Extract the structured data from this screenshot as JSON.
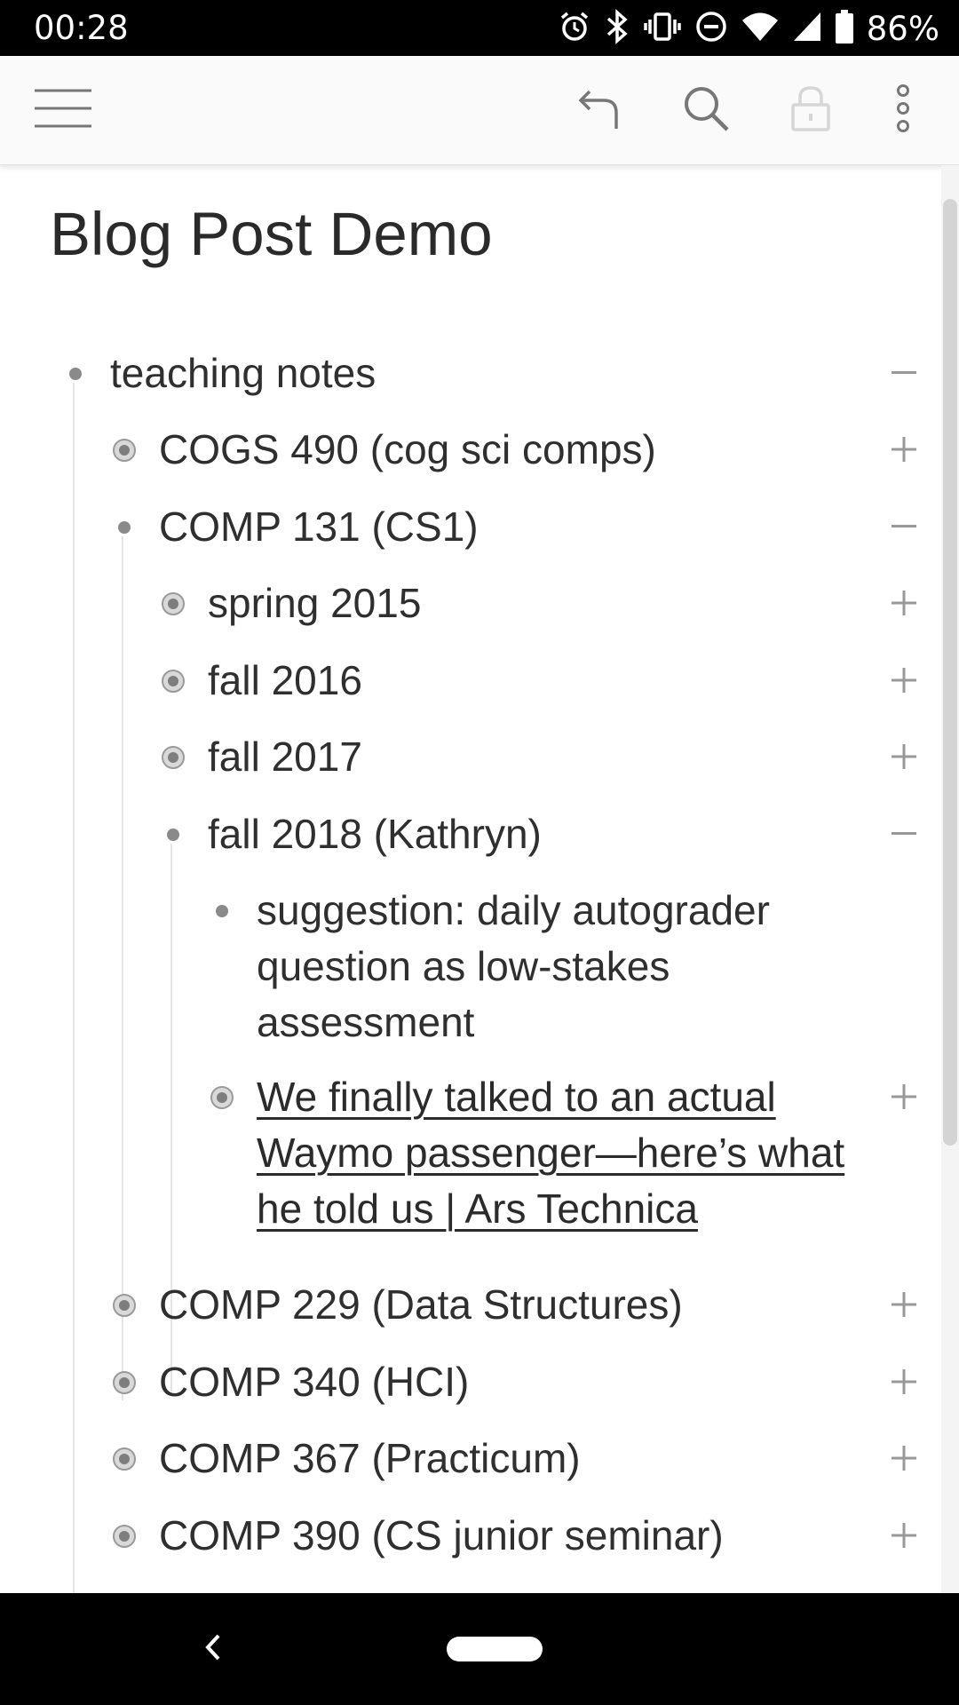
{
  "status_bar": {
    "time": "00:28",
    "battery": "86%",
    "icons": [
      "alarm-icon",
      "bluetooth-icon",
      "vibrate-icon",
      "do-not-disturb-icon",
      "wifi-icon",
      "signal-icon",
      "battery-icon"
    ]
  },
  "toolbar": {
    "icons": [
      "menu-icon",
      "undo-icon",
      "search-icon",
      "lock-icon",
      "more-options-icon"
    ]
  },
  "page": {
    "title": "Blog Post Demo"
  },
  "outline": {
    "items": [
      {
        "text": "teaching notes",
        "bullet": "dot",
        "toggle": "−"
      },
      {
        "text": "COGS 490 (cog sci comps)",
        "bullet": "collapsed",
        "toggle": "+"
      },
      {
        "text": "COMP 131 (CS1)",
        "bullet": "dot",
        "toggle": "−"
      },
      {
        "text": "spring 2015",
        "bullet": "collapsed",
        "toggle": "+"
      },
      {
        "text": "fall 2016",
        "bullet": "collapsed",
        "toggle": "+"
      },
      {
        "text": "fall 2017",
        "bullet": "collapsed",
        "toggle": "+"
      },
      {
        "text": "fall 2018 (Kathryn)",
        "bullet": "dot",
        "toggle": "−"
      },
      {
        "text": "suggestion: daily autograder question as low-stakes assessment",
        "bullet": "dot",
        "toggle": ""
      },
      {
        "text": "We finally talked to an actual Waymo passenger—here’s what he told us | Ars Technica",
        "bullet": "collapsed",
        "toggle": "+"
      },
      {
        "text": "COMP 229 (Data Structures)",
        "bullet": "collapsed",
        "toggle": "+"
      },
      {
        "text": "COMP 340 (HCI)",
        "bullet": "collapsed",
        "toggle": "+"
      },
      {
        "text": "COMP 367 (Practicum)",
        "bullet": "collapsed",
        "toggle": "+"
      },
      {
        "text": "COMP 390 (CS junior seminar)",
        "bullet": "collapsed",
        "toggle": "+"
      }
    ]
  },
  "colors": {
    "status_bar_bg": "#000000",
    "toolbar_bg": "#fafafa",
    "text": "#2f2f2f",
    "bullet": "#8a8a8a"
  }
}
